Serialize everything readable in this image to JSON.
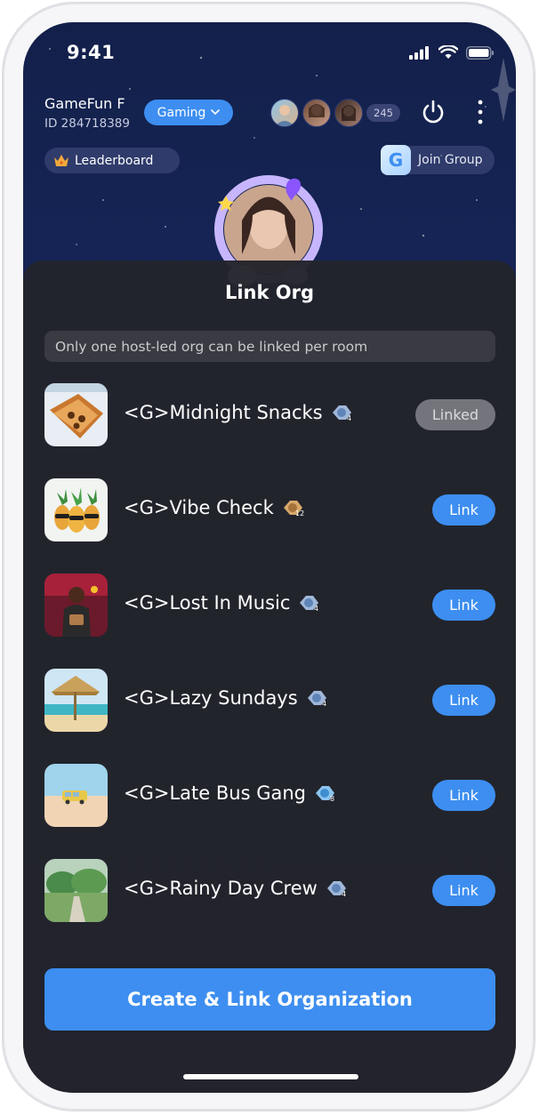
{
  "status_bar": {
    "time": "9:41"
  },
  "room": {
    "name": "GameFun F",
    "id_label": "ID 284718389",
    "category": "Gaming",
    "viewer_count": "245",
    "leaderboard_label": "Leaderboard",
    "join_group_label": "Join Group",
    "group_logo_letter": "G"
  },
  "sheet": {
    "title": "Link Org",
    "notice": "Only one host-led org can be linked per room",
    "orgs": [
      {
        "name": "<G>Midnight Snacks",
        "badge_level": "4",
        "action": "Linked"
      },
      {
        "name": "<G>Vibe Check",
        "badge_level": "12",
        "action": "Link"
      },
      {
        "name": "<G>Lost In Music",
        "badge_level": "4",
        "action": "Link"
      },
      {
        "name": "<G>Lazy Sundays",
        "badge_level": "4",
        "action": "Link"
      },
      {
        "name": "<G>Late Bus Gang",
        "badge_level": "8",
        "action": "Link"
      },
      {
        "name": "<G>Rainy Day Crew",
        "badge_level": "4",
        "action": "Link"
      }
    ],
    "create_button": "Create & Link Organization"
  },
  "colors": {
    "accent": "#3d8ef0",
    "linked": "#74757c",
    "sheet": "#23242c"
  }
}
